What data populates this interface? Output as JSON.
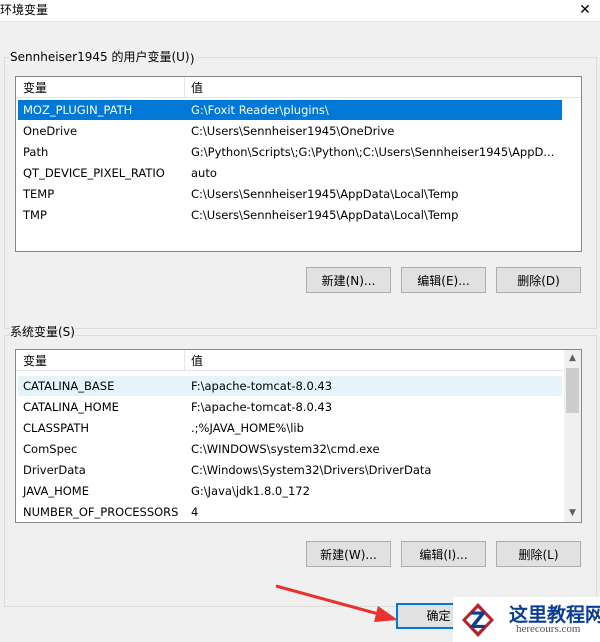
{
  "window": {
    "title": "环境变量",
    "close_glyph": "✕"
  },
  "user_vars": {
    "group_label": "Sennheiser1945 的用户变量(U)",
    "col_var": "变量",
    "col_val": "值",
    "rows": [
      {
        "name": "MOZ_PLUGIN_PATH",
        "value": "G:\\Foxit Reader\\plugins\\"
      },
      {
        "name": "OneDrive",
        "value": "C:\\Users\\Sennheiser1945\\OneDrive"
      },
      {
        "name": "Path",
        "value": "G:\\Python\\Scripts\\;G:\\Python\\;C:\\Users\\Sennheiser1945\\AppD..."
      },
      {
        "name": "QT_DEVICE_PIXEL_RATIO",
        "value": "auto"
      },
      {
        "name": "TEMP",
        "value": "C:\\Users\\Sennheiser1945\\AppData\\Local\\Temp"
      },
      {
        "name": "TMP",
        "value": "C:\\Users\\Sennheiser1945\\AppData\\Local\\Temp"
      }
    ],
    "buttons": {
      "new": "新建(N)...",
      "edit": "编辑(E)...",
      "delete": "删除(D)"
    }
  },
  "system_vars": {
    "group_label": "系统变量(S)",
    "col_var": "变量",
    "col_val": "值",
    "rows": [
      {
        "name": "CATALINA_BASE",
        "value": "F:\\apache-tomcat-8.0.43"
      },
      {
        "name": "CATALINA_HOME",
        "value": "F:\\apache-tomcat-8.0.43"
      },
      {
        "name": "CLASSPATH",
        "value": ".;%JAVA_HOME%\\lib"
      },
      {
        "name": "ComSpec",
        "value": "C:\\WINDOWS\\system32\\cmd.exe"
      },
      {
        "name": "DriverData",
        "value": "C:\\Windows\\System32\\Drivers\\DriverData"
      },
      {
        "name": "JAVA_HOME",
        "value": "G:\\Java\\jdk1.8.0_172"
      },
      {
        "name": "NUMBER_OF_PROCESSORS",
        "value": "4"
      }
    ],
    "buttons": {
      "new": "新建(W)...",
      "edit": "编辑(I)...",
      "delete": "删除(L)"
    }
  },
  "footer": {
    "ok": "确定"
  },
  "watermark": {
    "line1": "这里教程网",
    "line2": "herecours.com"
  },
  "colors": {
    "selection": "#0078d7",
    "annotation_arrow": "#e8322f"
  },
  "icons": {
    "scroll_up": "▲",
    "scroll_down": "▼"
  }
}
